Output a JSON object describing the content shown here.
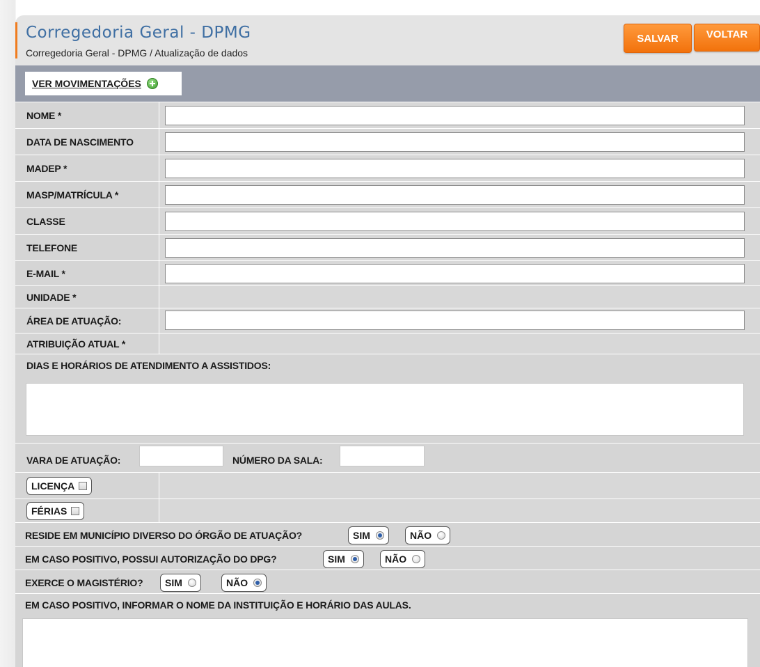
{
  "header": {
    "title": "Corregedoria Geral - DPMG",
    "breadcrumb": "Corregedoria Geral - DPMG / Atualização de dados",
    "save_label": "SALVAR",
    "back_label": "VOLTAR",
    "accent_color": "#f07c1e"
  },
  "toolbar": {
    "ver_movimentacoes_label": "VER MOVIMENTAÇÕES",
    "add_icon": "plus-circle-icon"
  },
  "fields": {
    "nome": {
      "label": "NOME *",
      "value": ""
    },
    "data_nascimento": {
      "label": "DATA DE NASCIMENTO",
      "value": ""
    },
    "madep": {
      "label": "MADEP *",
      "value": ""
    },
    "masp": {
      "label": "MASP/MATRÍCULA *",
      "value": ""
    },
    "classe": {
      "label": "CLASSE",
      "value": ""
    },
    "telefone": {
      "label": "TELEFONE",
      "value": ""
    },
    "email": {
      "label": "E-MAIL *",
      "value": ""
    },
    "unidade": {
      "label": "UNIDADE *"
    },
    "area_atuacao": {
      "label": "ÁREA DE ATUAÇÃO:",
      "value": ""
    },
    "atribuicao_atual": {
      "label": "ATRIBUIÇÃO ATUAL *"
    },
    "dias_horarios": {
      "label": "DIAS E HORÁRIOS DE ATENDIMENTO A ASSISTIDOS:",
      "value": ""
    },
    "vara_atuacao": {
      "label": "VARA DE ATUAÇÃO:",
      "value": ""
    },
    "numero_sala": {
      "label": "NÚMERO DA SALA:",
      "value": ""
    },
    "licenca": {
      "label": "LICENÇA",
      "checked": false
    },
    "ferias": {
      "label": "FÉRIAS",
      "checked": false
    },
    "reside": {
      "label": "RESIDE EM MUNICÍPIO DIVERSO DO ÓRGÃO DE ATUAÇÃO?",
      "sim_label": "SIM",
      "nao_label": "NÃO",
      "selected": "SIM"
    },
    "autorizacao": {
      "label": "EM CASO POSITIVO, POSSUI AUTORIZAÇÃO DO DPG?",
      "sim_label": "SIM",
      "nao_label": "NÃO",
      "selected": "SIM"
    },
    "magisterio": {
      "label": "EXERCE O MAGISTÉRIO?",
      "sim_label": "SIM",
      "nao_label": "NÃO",
      "selected": "NÃO"
    },
    "instituicao": {
      "label": "EM CASO POSITIVO, INFORMAR O NOME DA INSTITUIÇÃO E HORÁRIO DAS AULAS.",
      "value": ""
    }
  }
}
